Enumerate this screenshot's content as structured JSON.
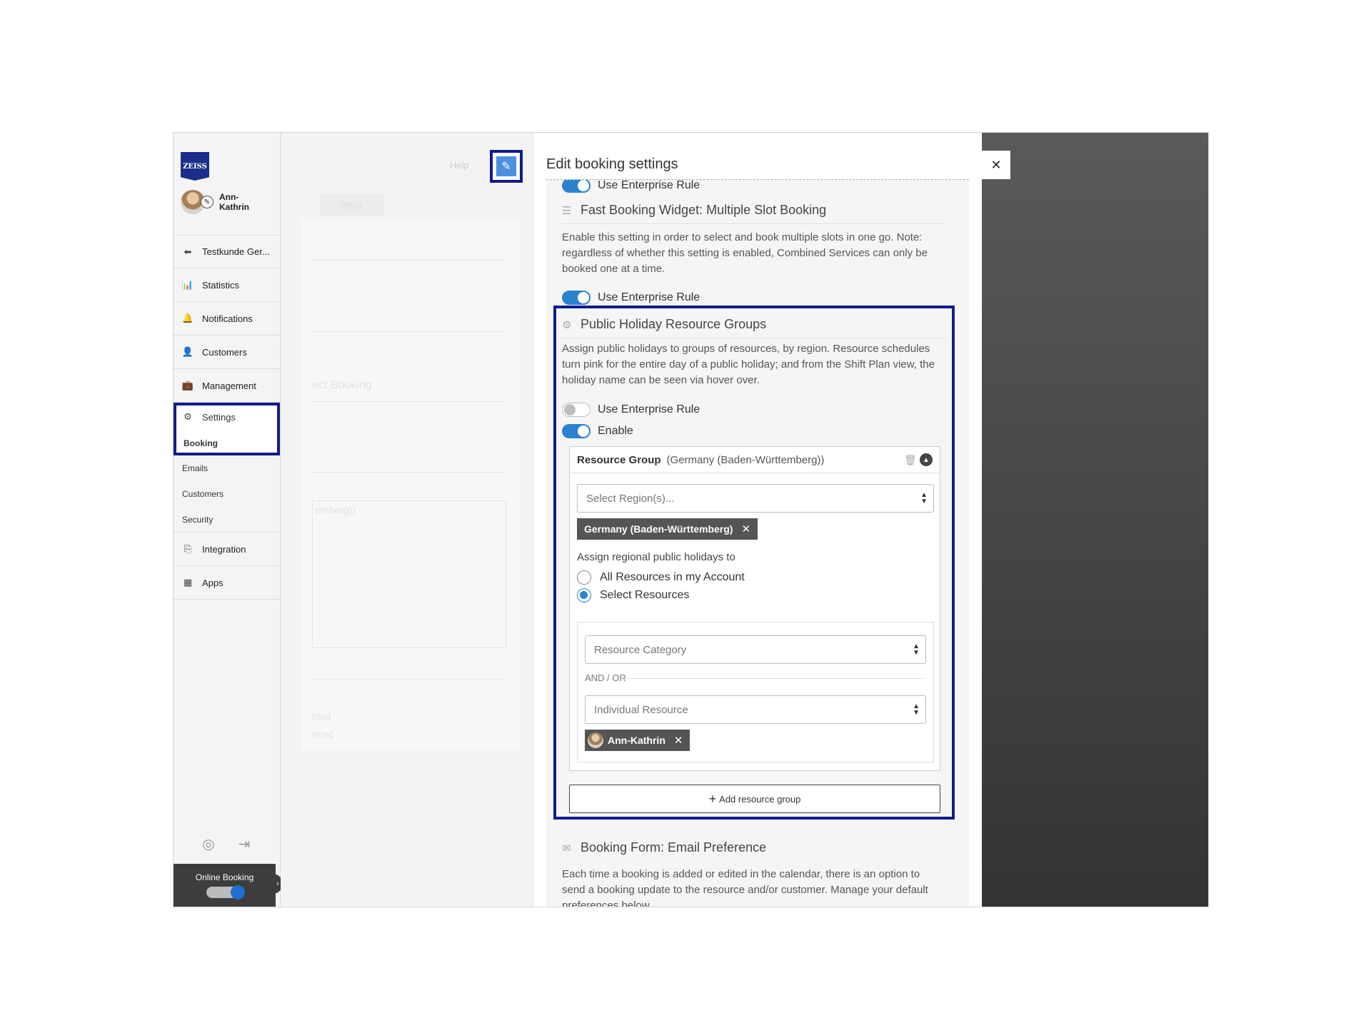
{
  "sidebar": {
    "logo_text": "ZEISS",
    "user_name": "Ann-Kathrin",
    "items": [
      {
        "label": "Testkunde Ger...",
        "icon": "back-circle-icon"
      },
      {
        "label": "Statistics",
        "icon": "chart-icon"
      },
      {
        "label": "Notifications",
        "icon": "bell-icon"
      },
      {
        "label": "Customers",
        "icon": "user-icon"
      },
      {
        "label": "Management",
        "icon": "briefcase-icon"
      }
    ],
    "settings": {
      "label": "Settings",
      "sub_active": "Booking"
    },
    "sub_items": [
      "Emails",
      "Customers",
      "Security"
    ],
    "items2": [
      {
        "label": "Integration",
        "icon": "integration-icon"
      },
      {
        "label": "Apps",
        "icon": "grid-icon"
      }
    ],
    "online_booking_label": "Online Booking"
  },
  "middle": {
    "help_label": "Help",
    "ghost_tag": "Other",
    "ghost_booking": "ect Booking",
    "ghost_region": "emberg))",
    "ghost_text1": "bled",
    "ghost_text2": "nced"
  },
  "modal": {
    "title": "Edit booking settings",
    "top_toggle_label": "Use Enterprise Rule",
    "fast_booking": {
      "title": "Fast Booking Widget: Multiple Slot Booking",
      "description": "Enable this setting in order to select and book multiple slots in one go. Note: regardless of whether this setting is enabled, Combined Services can only be booked one at a time.",
      "toggle_label": "Use Enterprise Rule"
    },
    "public_holiday": {
      "title": "Public Holiday Resource Groups",
      "description": "Assign public holidays to groups of resources, by region. Resource schedules turn pink for the entire day of a public holiday; and from the Shift Plan view, the holiday name can be seen via hover over.",
      "enterprise_label": "Use Enterprise Rule",
      "enable_label": "Enable",
      "resource_group": {
        "label": "Resource Group",
        "region": "(Germany (Baden-Württemberg))",
        "region_placeholder": "Select Region(s)...",
        "region_chip": "Germany (Baden-Württemberg)",
        "assign_label": "Assign regional public holidays to",
        "option_all": "All Resources in my Account",
        "option_select": "Select Resources",
        "category_placeholder": "Resource Category",
        "andor": "AND / OR",
        "individual_placeholder": "Individual Resource",
        "resource_chip": "Ann-Kathrin"
      },
      "add_button": "Add resource group"
    },
    "email_pref": {
      "title": "Booking Form: Email Preference",
      "description": "Each time a booking is added or edited in the calendar, there is an option to send a booking update to the resource and/or customer. Manage your default preferences below."
    }
  },
  "colors": {
    "accent": "#2c82cf",
    "highlight": "#101c8c"
  }
}
